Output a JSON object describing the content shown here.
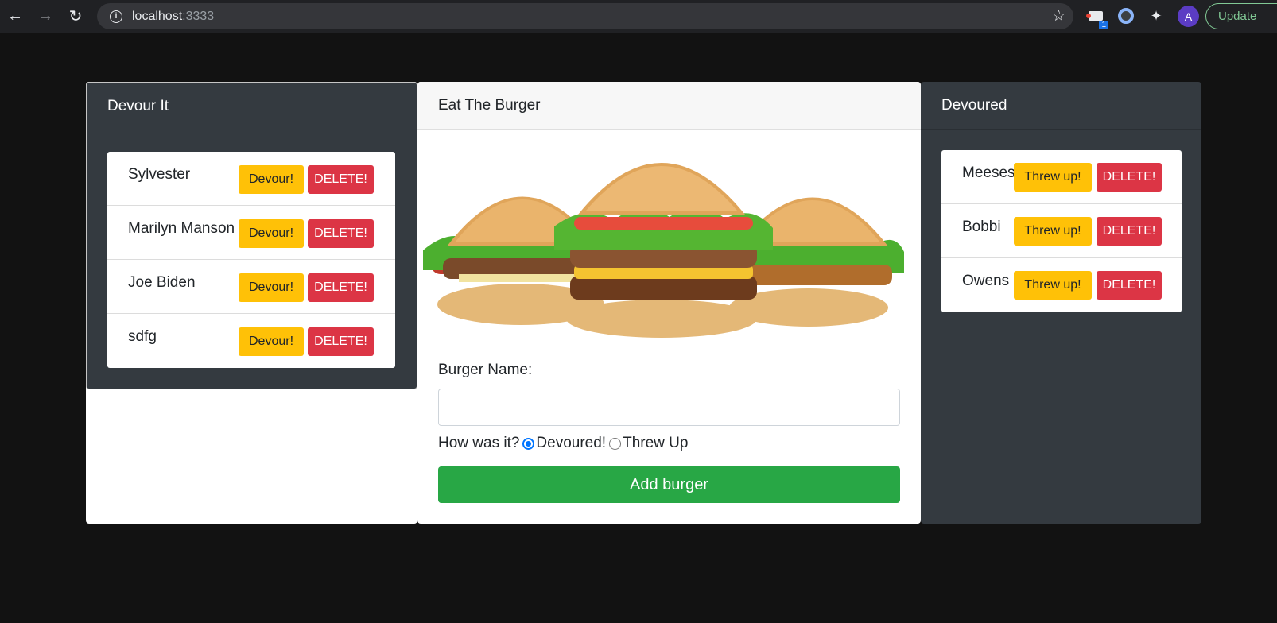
{
  "browser": {
    "host": "localhost",
    "port": ":3333",
    "extension_badge": "1",
    "avatar_letter": "A",
    "update_label": "Update"
  },
  "left": {
    "title": "Devour It",
    "items": [
      {
        "name": "Sylvester",
        "devour": "Devour!",
        "delete": "DELETE!"
      },
      {
        "name": "Marilyn Manson",
        "devour": "Devour!",
        "delete": "DELETE!"
      },
      {
        "name": "Joe Biden",
        "devour": "Devour!",
        "delete": "DELETE!"
      },
      {
        "name": "sdfg",
        "devour": "Devour!",
        "delete": "DELETE!"
      }
    ]
  },
  "center": {
    "title": "Eat The Burger",
    "name_label": "Burger Name:",
    "name_value": "",
    "question": "How was it?",
    "option_devoured": "Devoured!",
    "option_threw": "Threw Up",
    "submit_label": "Add burger"
  },
  "right": {
    "title": "Devoured",
    "items": [
      {
        "name": "Meeses",
        "threw": "Threw up!",
        "delete": "DELETE!"
      },
      {
        "name": "Bobbi",
        "threw": "Threw up!",
        "delete": "DELETE!"
      },
      {
        "name": "Owens",
        "threw": "Threw up!",
        "delete": "DELETE!"
      }
    ]
  },
  "colors": {
    "warning": "#ffc107",
    "danger": "#dc3545",
    "success": "#28a745",
    "dark": "#343a40"
  }
}
